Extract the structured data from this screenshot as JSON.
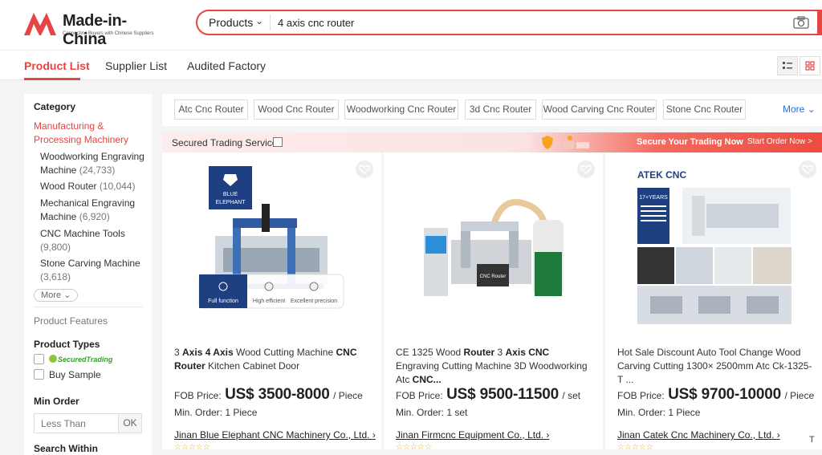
{
  "brand": {
    "name": "Made-in-China",
    "tagline": "Connecting Buyers with Chinese Suppliers",
    "color": "#e64545"
  },
  "search": {
    "category": "Products",
    "query": "4 axis cnc router"
  },
  "tabs": [
    {
      "label": "Product List",
      "active": true
    },
    {
      "label": "Supplier List",
      "active": false
    },
    {
      "label": "Audited Factory",
      "active": false
    }
  ],
  "sidebar": {
    "category_title": "Category",
    "active_category": "Manufacturing & Processing Machinery",
    "items": [
      {
        "label": "Woodworking Engraving Machine",
        "count": "(24,733)"
      },
      {
        "label": "Wood Router",
        "count": "(10,044)"
      },
      {
        "label": "Mechanical Engraving Machine",
        "count": "(6,920)"
      },
      {
        "label": "CNC Machine Tools",
        "count": "(9,800)"
      },
      {
        "label": "Stone Carving Machine",
        "count": "(3,618)"
      }
    ],
    "more_label": "More",
    "product_features": "Product Features",
    "product_types_title": "Product Types",
    "secured_trading": "SecuredTrading",
    "buy_sample": "Buy Sample",
    "min_order_title": "Min Order",
    "min_order_placeholder": "Less Than",
    "ok_label": "OK",
    "search_within": "Search Within"
  },
  "chips": [
    "Atc Cnc Router",
    "Wood Cnc Router",
    "Woodworking Cnc Router",
    "3d Cnc Router",
    "Wood Carving Cnc Router",
    "Stone Cnc Router"
  ],
  "chips_more": "More",
  "secure_bar": {
    "label": "Secured Trading Service",
    "promo": "Secure Your Trading Now",
    "start": "Start Order Now >"
  },
  "products": [
    {
      "title_parts": [
        "3 ",
        "Axis",
        " ",
        "4 Axis",
        " Wood Cutting Machine ",
        "CNC Router",
        " Kitchen Cabinet Door"
      ],
      "price_label": "FOB Price:",
      "price": "US$ 3500-8000",
      "unit": "/ Piece",
      "min_order": "Min. Order: 1 Piece",
      "supplier": "Jinan Blue Elephant CNC Machinery Co., Ltd.",
      "img_badge": [
        "BLUE",
        "ELEPHANT"
      ],
      "img_features": [
        "Full function",
        "High efficient",
        "Excellent precision"
      ]
    },
    {
      "title_parts": [
        "CE 1325 Wood ",
        "Router",
        " 3 ",
        "Axis CNC",
        " Engraving Cutting Machine 3D Woodworking Atc ",
        "CNC..."
      ],
      "price_label": "FOB Price:",
      "price": "US$ 9500-11500",
      "unit": "/ set",
      "min_order": "Min. Order: 1 set",
      "supplier": "Jinan Firmcnc Equipment Co., Ltd.",
      "img_label": "CNC Router"
    },
    {
      "title_parts": [
        "Hot Sale Discount Auto Tool Change Wood Carving Cutting 1300× 2500mm Atc Ck-1325-T ..."
      ],
      "price_label": "FOB Price:",
      "price": "US$ 9700-10000",
      "unit": "/ Piece",
      "min_order": "Min. Order: 1 Piece",
      "supplier": "Jinan Catek Cnc Machinery Co., Ltd.",
      "img_brand": "ATEK CNC",
      "img_years": "17+YEARS"
    }
  ],
  "edge_fragment": "T"
}
